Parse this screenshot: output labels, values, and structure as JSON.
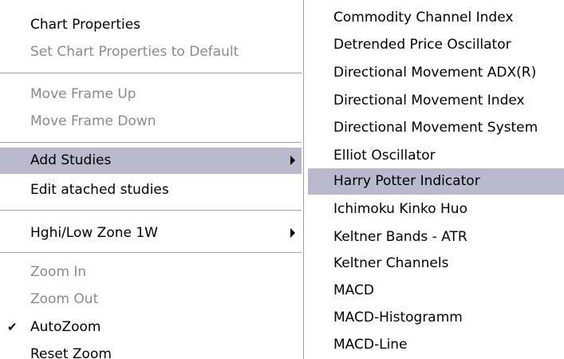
{
  "main_menu": {
    "chart_properties": "Chart Properties",
    "set_default": "Set Chart Properties to Default",
    "move_frame_up": "Move Frame Up",
    "move_frame_down": "Move Frame Down",
    "add_studies": "Add Studies",
    "edit_studies": "Edit atached studies",
    "high_low_zone": "Hghi/Low Zone 1W",
    "zoom_in": "Zoom In",
    "zoom_out": "Zoom Out",
    "autozoom": "AutoZoom",
    "autozoom_checked": true,
    "reset_zoom": "Reset Zoom"
  },
  "submenu": {
    "items": [
      "Commodity Channel Index",
      "Detrended Price Oscillator",
      "Directional Movement ADX(R)",
      "Directional Movement Index",
      "Directional Movement System",
      "Elliot Oscillator",
      "Harry Potter Indicator",
      "Ichimoku Kinko Huo",
      "Keltner Bands - ATR",
      "Keltner Channels",
      "MACD",
      "MACD-Histogramm",
      "MACD-Line"
    ],
    "highlighted_index": 6
  },
  "colors": {
    "highlight": "#b9b8cc",
    "disabled_text": "#8a8a8a",
    "separator": "#a0a0a0"
  }
}
